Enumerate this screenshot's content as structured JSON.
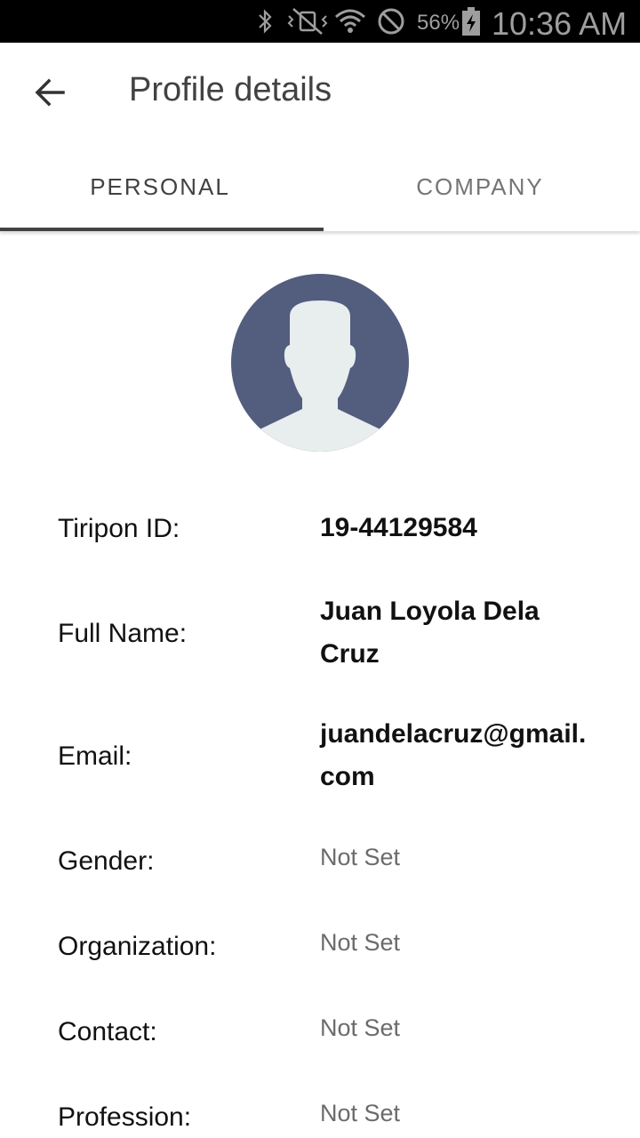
{
  "status_bar": {
    "battery_percent": "56%",
    "time": "10:36 AM",
    "icons": [
      "bluetooth-icon",
      "vibrate-icon",
      "wifi-icon",
      "do-not-disturb-icon",
      "battery-charging-icon"
    ]
  },
  "app_bar": {
    "back_icon": "arrow-left-icon",
    "title": "Profile details"
  },
  "tabs": [
    {
      "label": "PERSONAL",
      "active": true
    },
    {
      "label": "COMPANY",
      "active": false
    }
  ],
  "avatar": {
    "icon": "default-user-avatar-icon",
    "bg_color": "#535d7e",
    "fg_color": "#e8edee"
  },
  "details": [
    {
      "label": "Tiripon ID:",
      "value": "19-44129584"
    },
    {
      "label": "Full Name:",
      "value": "Juan Loyola Dela Cruz"
    },
    {
      "label": "Email:",
      "value": "juandelacruz@gmail.com"
    },
    {
      "label": "Gender:",
      "value": "Not Set"
    },
    {
      "label": "Organization:",
      "value": "Not Set"
    },
    {
      "label": "Contact:",
      "value": "Not Set"
    },
    {
      "label": "Profession:",
      "value": "Not Set"
    }
  ]
}
